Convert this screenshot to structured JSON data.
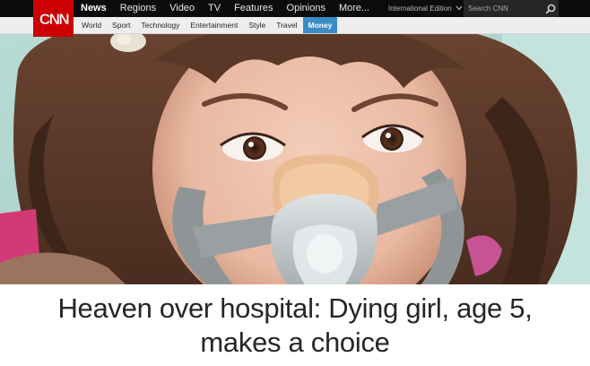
{
  "brand": {
    "logo_text": "CNN",
    "color": "#cc0000"
  },
  "primary_nav": [
    {
      "label": "News",
      "active": true
    },
    {
      "label": "Regions",
      "active": false
    },
    {
      "label": "Video",
      "active": false
    },
    {
      "label": "TV",
      "active": false
    },
    {
      "label": "Features",
      "active": false
    },
    {
      "label": "Opinions",
      "active": false
    },
    {
      "label": "More...",
      "active": false
    }
  ],
  "edition": {
    "label": "International Edition",
    "icon": "chevron-down-icon"
  },
  "search": {
    "placeholder": "Search CNN",
    "icon": "search-icon"
  },
  "sub_nav": [
    {
      "label": "World",
      "selected": false
    },
    {
      "label": "Sport",
      "selected": false
    },
    {
      "label": "Technology",
      "selected": false
    },
    {
      "label": "Entertainment",
      "selected": false
    },
    {
      "label": "Style",
      "selected": false
    },
    {
      "label": "Travel",
      "selected": false
    },
    {
      "label": "Money",
      "selected": true
    }
  ],
  "colors": {
    "topbar": "#0c0c0c",
    "subbar": "#eeeeee",
    "selected_tab": "#3b8bc4"
  },
  "headline": "Heaven over hospital: Dying girl, age 5, makes a choice"
}
